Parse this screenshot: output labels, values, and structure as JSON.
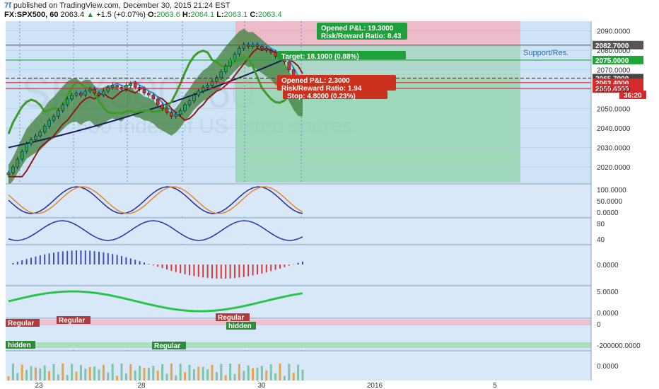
{
  "header": {
    "logo": "7f",
    "published": "published on TradingView.com, December 30, 2015 21:24 EST",
    "symbol": "FX:SPX500, 60",
    "last": "2063.4",
    "change": "+1.5 (+0.07%)",
    "open_label": "O:",
    "open": "2063.6",
    "high_label": "H:",
    "high": "2064.1",
    "low_label": "L:",
    "low": "2063.1",
    "close_label": "C:",
    "close": "2063.4"
  },
  "watermark": {
    "symbol": "SPX500, 60",
    "description": "S&P 500 Index of US listed shares"
  },
  "chart_data": {
    "type": "candlestick",
    "price_axis": {
      "ylim": [
        2012,
        2095
      ],
      "ticks": [
        2090,
        2080,
        2070,
        2060,
        2050,
        2040,
        2030,
        2020
      ],
      "tick_labels": [
        "2090.0000",
        "2080.0000",
        "2070.0000",
        "2060.0000",
        "2050.0000",
        "2040.0000",
        "2030.0000",
        "2020.0000"
      ]
    },
    "x_axis": {
      "tick_labels": [
        "23",
        "28",
        "30",
        "2016",
        "5"
      ]
    },
    "close_series": [
      2017,
      2020,
      2024,
      2028,
      2032,
      2034,
      2036,
      2038,
      2041,
      2044,
      2046,
      2049,
      2052,
      2055,
      2057,
      2058,
      2057,
      2059,
      2060,
      2058,
      2057,
      2059,
      2061,
      2062,
      2061,
      2060,
      2062,
      2063,
      2061,
      2060,
      2058,
      2057,
      2055,
      2052,
      2050,
      2048,
      2046,
      2047,
      2049,
      2052,
      2054,
      2057,
      2059,
      2061,
      2062,
      2064,
      2066,
      2069,
      2072,
      2075,
      2078,
      2081,
      2083,
      2082,
      2083,
      2082,
      2081,
      2080,
      2079,
      2077,
      2076,
      2074,
      2070,
      2066,
      2063,
      2063
    ],
    "horizontal_levels": [
      {
        "price": 2082.7,
        "label": "2082.7000",
        "color": "#555555"
      },
      {
        "price": 2075.0,
        "label": "2075.0000",
        "color": "#1fa83a"
      },
      {
        "price": 2065.7,
        "label": "2065.7000",
        "color": "#444444"
      },
      {
        "price": 2063.4,
        "label": "2063.4000",
        "color": "#d42a2a"
      },
      {
        "price": 2060.4,
        "label": "2060.4000",
        "color": "#d42a2a"
      }
    ],
    "countdown": "36:20",
    "support_label": "Support/Res.",
    "long_trade": {
      "label1": "Opened P&L: 19.3000",
      "label2": "Risk/Reward Ratio: 8.43",
      "target_label": "Target: 18.1000 (0.88%)"
    },
    "short_trade": {
      "label1": "Opened P&L: 2.3000",
      "label2": "Risk/Reward Ratio: 1.94",
      "stop_label": "Stop: 4.8000 (0.23%)"
    },
    "panels": [
      {
        "name": "stochastic",
        "tick_labels": [
          "100.0000",
          "50.0000",
          "0.0000"
        ]
      },
      {
        "name": "rsi",
        "tick_labels": [
          "80",
          "40"
        ]
      },
      {
        "name": "macd-histogram",
        "tick_labels": [
          "0.0000"
        ]
      },
      {
        "name": "oscillator",
        "tick_labels": [
          "5.0000",
          "0.0000"
        ]
      },
      {
        "name": "divergence",
        "tick_labels": [
          "0",
          "-200000.0000"
        ],
        "labels": [
          "Regular",
          "Regular",
          "Regular",
          "hidden",
          "hidden",
          "Regular"
        ]
      },
      {
        "name": "volume",
        "tick_labels": [
          "0.0000"
        ]
      }
    ]
  },
  "colors": {
    "chart_bg": "#cfe3f7",
    "up": "#2aa34a",
    "down": "#d43030",
    "target_zone": "#8ed3a6",
    "stop_zone": "#f3b4c2",
    "cloud": "#3f7f3a"
  }
}
